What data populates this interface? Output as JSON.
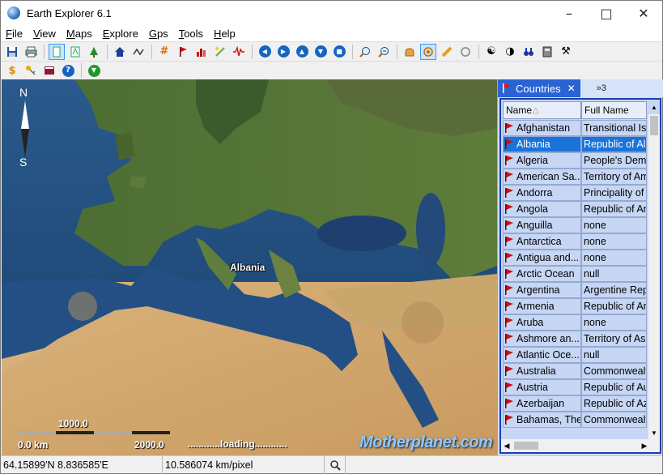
{
  "window": {
    "title": "Earth Explorer 6.1",
    "controls": {
      "minimize": "–",
      "maximize": "□",
      "close": "✕"
    }
  },
  "menu": [
    "File",
    "View",
    "Maps",
    "Explore",
    "Gps",
    "Tools",
    "Help"
  ],
  "toolbar1_icons": [
    "save-icon",
    "print-icon",
    "select-icon",
    "map-mode-icon",
    "tree-icon",
    "home-icon",
    "route-icon",
    "grid-icon",
    "flag-icon",
    "chart-icon",
    "measure-icon",
    "signal-icon",
    "back-icon",
    "forward-icon",
    "up-icon",
    "down-icon",
    "stop-icon",
    "zoom-in-icon",
    "zoom-out-icon",
    "pan-icon",
    "target-icon",
    "ruler-icon",
    "refresh-icon",
    "yin-yang-icon",
    "contrast-icon",
    "binoculars-icon",
    "calculator-icon",
    "tools-icon"
  ],
  "toolbar2_icons": [
    "dollar-icon",
    "key-icon",
    "book-icon",
    "help-icon",
    "download-icon"
  ],
  "map": {
    "compass": {
      "north": "N",
      "south": "S"
    },
    "label": "Albania",
    "scale": {
      "top": "1000.0",
      "left": "0.0 km",
      "right": "2000.0"
    },
    "loading": "............loading............",
    "watermark": "Motherplanet.com"
  },
  "panel": {
    "tab_label": "Countries",
    "tab_close": "✕",
    "more_tabs": "»3",
    "columns": {
      "name": "Name",
      "full_name": "Full Name"
    },
    "sort_indicator": "△",
    "selected_index": 1,
    "rows": [
      {
        "name": "Afghanistan",
        "full": "Transitional Islamic State of Afghanistan"
      },
      {
        "name": "Albania",
        "full": "Republic of Albania"
      },
      {
        "name": "Algeria",
        "full": "People's Democratic Republic of Algeria"
      },
      {
        "name": "American Sa...",
        "full": "Territory of American Samoa"
      },
      {
        "name": "Andorra",
        "full": "Principality of Andorra"
      },
      {
        "name": "Angola",
        "full": "Republic of Angola"
      },
      {
        "name": "Anguilla",
        "full": "none"
      },
      {
        "name": "Antarctica",
        "full": "none"
      },
      {
        "name": "Antigua and...",
        "full": "none"
      },
      {
        "name": "Arctic Ocean",
        "full": "null"
      },
      {
        "name": "Argentina",
        "full": "Argentine Republic"
      },
      {
        "name": "Armenia",
        "full": "Republic of Armenia"
      },
      {
        "name": "Aruba",
        "full": "none"
      },
      {
        "name": "Ashmore an...",
        "full": "Territory of Ashmore and Cartier Islands"
      },
      {
        "name": "Atlantic Oce...",
        "full": "null"
      },
      {
        "name": "Australia",
        "full": "Commonwealth of Australia"
      },
      {
        "name": "Austria",
        "full": "Republic of Austria"
      },
      {
        "name": "Azerbaijan",
        "full": "Republic of Azerbaijan"
      },
      {
        "name": "Bahamas, The",
        "full": "Commonwealth of The Bahamas"
      }
    ]
  },
  "status": {
    "coords": "64.15899'N  8.836585'E",
    "resolution": "10.586074 km/pixel",
    "search_icon": "magnifier-icon",
    "extra": ""
  },
  "colors": {
    "selection": "#1a73d9",
    "panel_tab": "#2a64d4",
    "grid_bg": "#c6d6f4",
    "flag_red": "#cc1111"
  }
}
